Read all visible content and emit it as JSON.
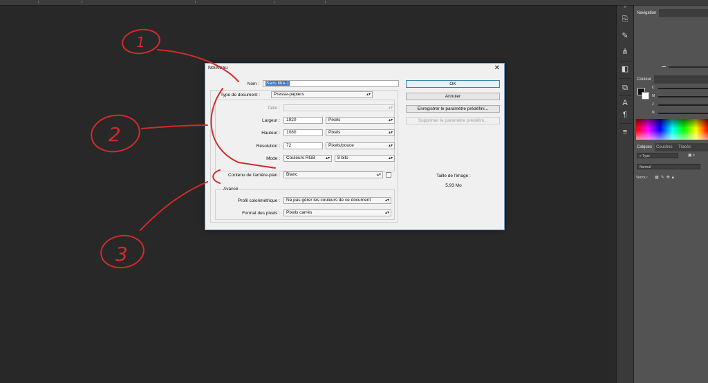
{
  "dialog": {
    "title": "Nouveau",
    "close": "✕",
    "nom_label": "Nom :",
    "nom_value": "Sans titre-1",
    "type_label": "Type de document :",
    "type_value": "Presse-papiers",
    "taille_label": "Taille :",
    "taille_value": "",
    "largeur_label": "Largeur :",
    "largeur_value": "1920",
    "largeur_unit": "Pixels",
    "hauteur_label": "Hauteur :",
    "hauteur_value": "1080",
    "hauteur_unit": "Pixels",
    "resolution_label": "Résolution :",
    "resolution_value": "72",
    "resolution_unit": "Pixels/pouce",
    "mode_label": "Mode :",
    "mode_value": "Couleurs RGB",
    "mode_bits": "8 bits",
    "fond_label": "Contenu de l'arrière-plan :",
    "fond_value": "Blanc",
    "avance_label": "Avancé",
    "profil_label": "Profil colorimétrique :",
    "profil_value": "Ne pas gérer les couleurs de ce document",
    "format_label": "Format des pixels :",
    "format_value": "Pixels carrés",
    "buttons": {
      "ok": "OK",
      "annuler": "Annuler",
      "enregistrer": "Enregistrer le paramètre prédéfini...",
      "supprimer": "Supprimer le paramètre prédéfini..."
    },
    "image_size_label": "Taille de l'image :",
    "image_size_value": "5,93 Mo"
  },
  "panels": {
    "navigation_tab": "Navigation",
    "couleur_tab": "Couleur",
    "cmyk": [
      "C",
      "M",
      "J",
      "N"
    ],
    "layers_tabs": [
      "Calques",
      "Couches",
      "Tracés"
    ],
    "layer_filter": "Type",
    "blend_mode": "Normal",
    "verrou": "Verrou :"
  },
  "annotations": [
    "1",
    "2",
    "3"
  ],
  "colors": {
    "annotation": "#d42a2a",
    "selection": "#3478c6"
  }
}
